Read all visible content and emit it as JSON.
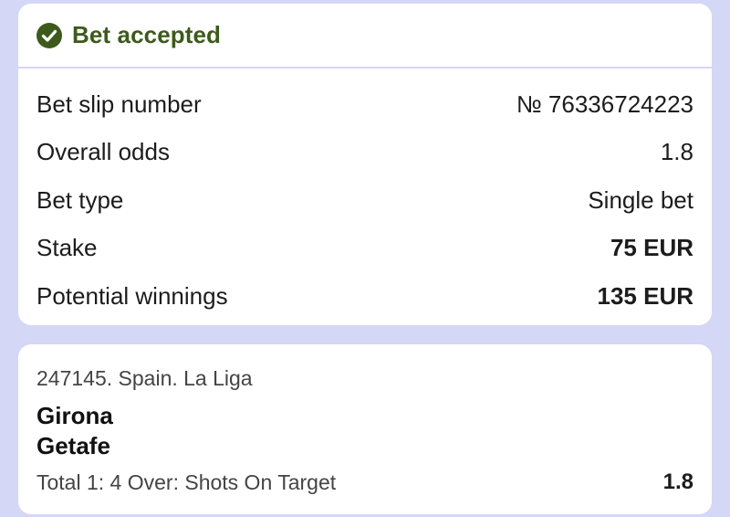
{
  "colors": {
    "background": "#d4d7f6",
    "card": "#ffffff",
    "accepted": "#3d5a1c"
  },
  "header": {
    "icon": "check-circle-icon",
    "title": "Bet accepted"
  },
  "details": [
    {
      "label": "Bet slip number",
      "value": "№ 76336724223",
      "bold": false
    },
    {
      "label": "Overall odds",
      "value": "1.8",
      "bold": false
    },
    {
      "label": "Bet type",
      "value": "Single bet",
      "bold": false
    },
    {
      "label": "Stake",
      "value": "75 EUR",
      "bold": true
    },
    {
      "label": "Potential winnings",
      "value": "135 EUR",
      "bold": true
    }
  ],
  "event": {
    "league": "247145. Spain. La Liga",
    "team_home": "Girona",
    "team_away": "Getafe",
    "market": "Total 1: 4 Over: Shots On Target",
    "odds": "1.8"
  }
}
